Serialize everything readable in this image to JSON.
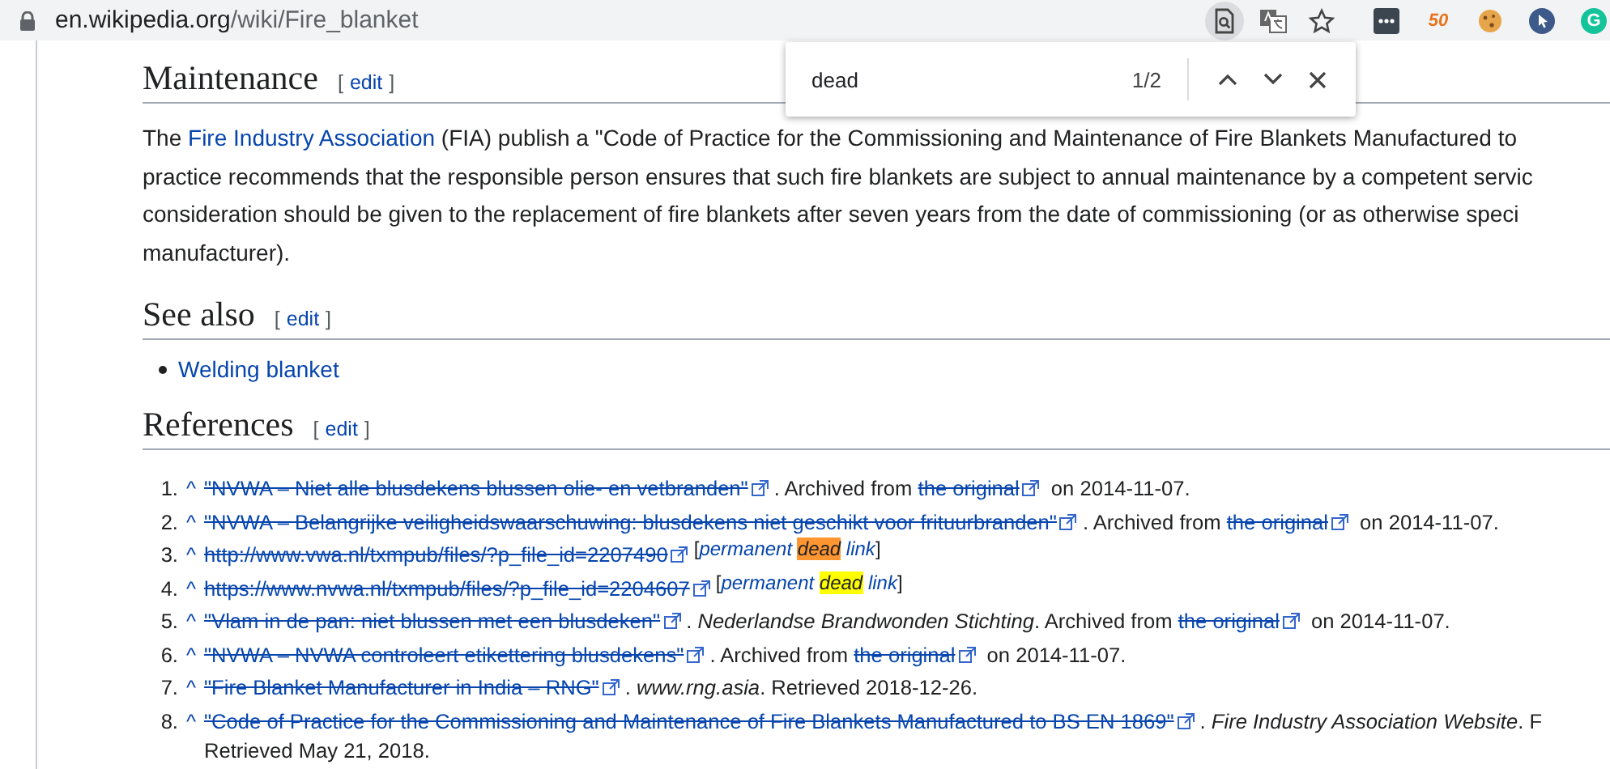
{
  "browser": {
    "url_host": "en.wikipedia.org",
    "url_path": "/wiki/Fire_blanket",
    "toolbar_icons": [
      {
        "kind": "find",
        "active": true
      },
      {
        "kind": "translate",
        "active": false
      },
      {
        "kind": "star",
        "active": false
      }
    ],
    "extensions": [
      {
        "kind": "dots"
      },
      {
        "kind": "badge",
        "label": "50"
      },
      {
        "kind": "cookie"
      },
      {
        "kind": "cursor"
      },
      {
        "kind": "grammar",
        "label": "G"
      }
    ]
  },
  "find_bar": {
    "query": "dead",
    "count": "1/2"
  },
  "maintenance": {
    "heading": "Maintenance",
    "edit": {
      "open": "[",
      "label": "edit",
      "close": "]"
    },
    "lines": [
      [
        {
          "kind": "text",
          "text": "The "
        },
        {
          "kind": "link",
          "text": "Fire Industry Association"
        },
        {
          "kind": "text",
          "text": " (FIA) publish a \"Code of Practice for the Commissioning and Maintenance of Fire Blankets Manufactured to"
        }
      ],
      [
        {
          "kind": "text",
          "text": "practice recommends that the responsible person ensures that such fire blankets are subject to annual maintenance by a competent servic"
        }
      ],
      [
        {
          "kind": "text",
          "text": "consideration should be given to the replacement of fire blankets after seven years from the date of commissioning (or as otherwise speci"
        }
      ],
      [
        {
          "kind": "text",
          "text": "manufacturer)."
        }
      ]
    ]
  },
  "see_also": {
    "heading": "See also",
    "edit": {
      "open": "[",
      "label": "edit",
      "close": "]"
    },
    "items": [
      "Welding blanket"
    ]
  },
  "references": {
    "heading": "References",
    "edit": {
      "open": "[",
      "label": "edit",
      "close": "]"
    },
    "items": [
      {
        "number": "1.",
        "caret": "^",
        "parts": [
          {
            "kind": "dead_link",
            "text": "\"NVWA – Niet alle blusdekens blussen olie- en vetbranden\""
          },
          {
            "kind": "text",
            "text": ". Archived from "
          },
          {
            "kind": "dead_link",
            "text": "the original"
          },
          {
            "kind": "text",
            "text": " on 2014-11-07."
          }
        ]
      },
      {
        "number": "2.",
        "caret": "^",
        "parts": [
          {
            "kind": "dead_link",
            "text": "\"NVWA – Belangrijke veiligheidswaarschuwing: blusdekens niet geschikt voor frituurbranden\""
          },
          {
            "kind": "text",
            "text": ". Archived from "
          },
          {
            "kind": "dead_link",
            "text": "the original"
          },
          {
            "kind": "text",
            "text": " on 2014-11-07."
          }
        ]
      },
      {
        "number": "3.",
        "caret": "^",
        "parts": [
          {
            "kind": "dead_link",
            "text": "http://www.vwa.nl/txmpub/files/?p_file_id=2207490"
          },
          {
            "kind": "tag",
            "open": "[",
            "before": "permanent ",
            "match": "dead",
            "after": " link",
            "close": "]",
            "selected": true
          }
        ]
      },
      {
        "number": "4.",
        "caret": "^",
        "parts": [
          {
            "kind": "dead_link",
            "text": "https://www.nvwa.nl/txmpub/files/?p_file_id=2204607"
          },
          {
            "kind": "tag",
            "open": "[",
            "before": "permanent ",
            "match": "dead",
            "after": " link",
            "close": "]",
            "selected": false
          }
        ]
      },
      {
        "number": "5.",
        "caret": "^",
        "parts": [
          {
            "kind": "dead_link",
            "text": "\"Vlam in de pan: niet blussen met een blusdeken\""
          },
          {
            "kind": "text",
            "text": ". *Nederlandse Brandwonden Stichting*. Archived from "
          },
          {
            "kind": "dead_link",
            "text": "the original"
          },
          {
            "kind": "text",
            "text": " on 2014-11-07."
          }
        ]
      },
      {
        "number": "6.",
        "caret": "^",
        "parts": [
          {
            "kind": "dead_link",
            "text": "\"NVWA – NVWA controleert etikettering blusdekens\""
          },
          {
            "kind": "text",
            "text": ". Archived from "
          },
          {
            "kind": "dead_link",
            "text": "the original"
          },
          {
            "kind": "text",
            "text": " on 2014-11-07."
          }
        ]
      },
      {
        "number": "7.",
        "caret": "^",
        "parts": [
          {
            "kind": "dead_link",
            "text": "\"Fire Blanket Manufacturer in India – RNG\""
          },
          {
            "kind": "text",
            "text": ". *www.rng.asia*. Retrieved 2018-12-26."
          }
        ]
      },
      {
        "number": "8.",
        "caret": "^",
        "parts": [
          {
            "kind": "dead_link",
            "text": "\"Code of Practice for the Commissioning and Maintenance of Fire Blankets Manufactured to BS EN 1869\""
          },
          {
            "kind": "text",
            "text": ". *Fire Industry Association Website*. F"
          }
        ],
        "continuation": "Retrieved May 21, 2018."
      }
    ]
  }
}
